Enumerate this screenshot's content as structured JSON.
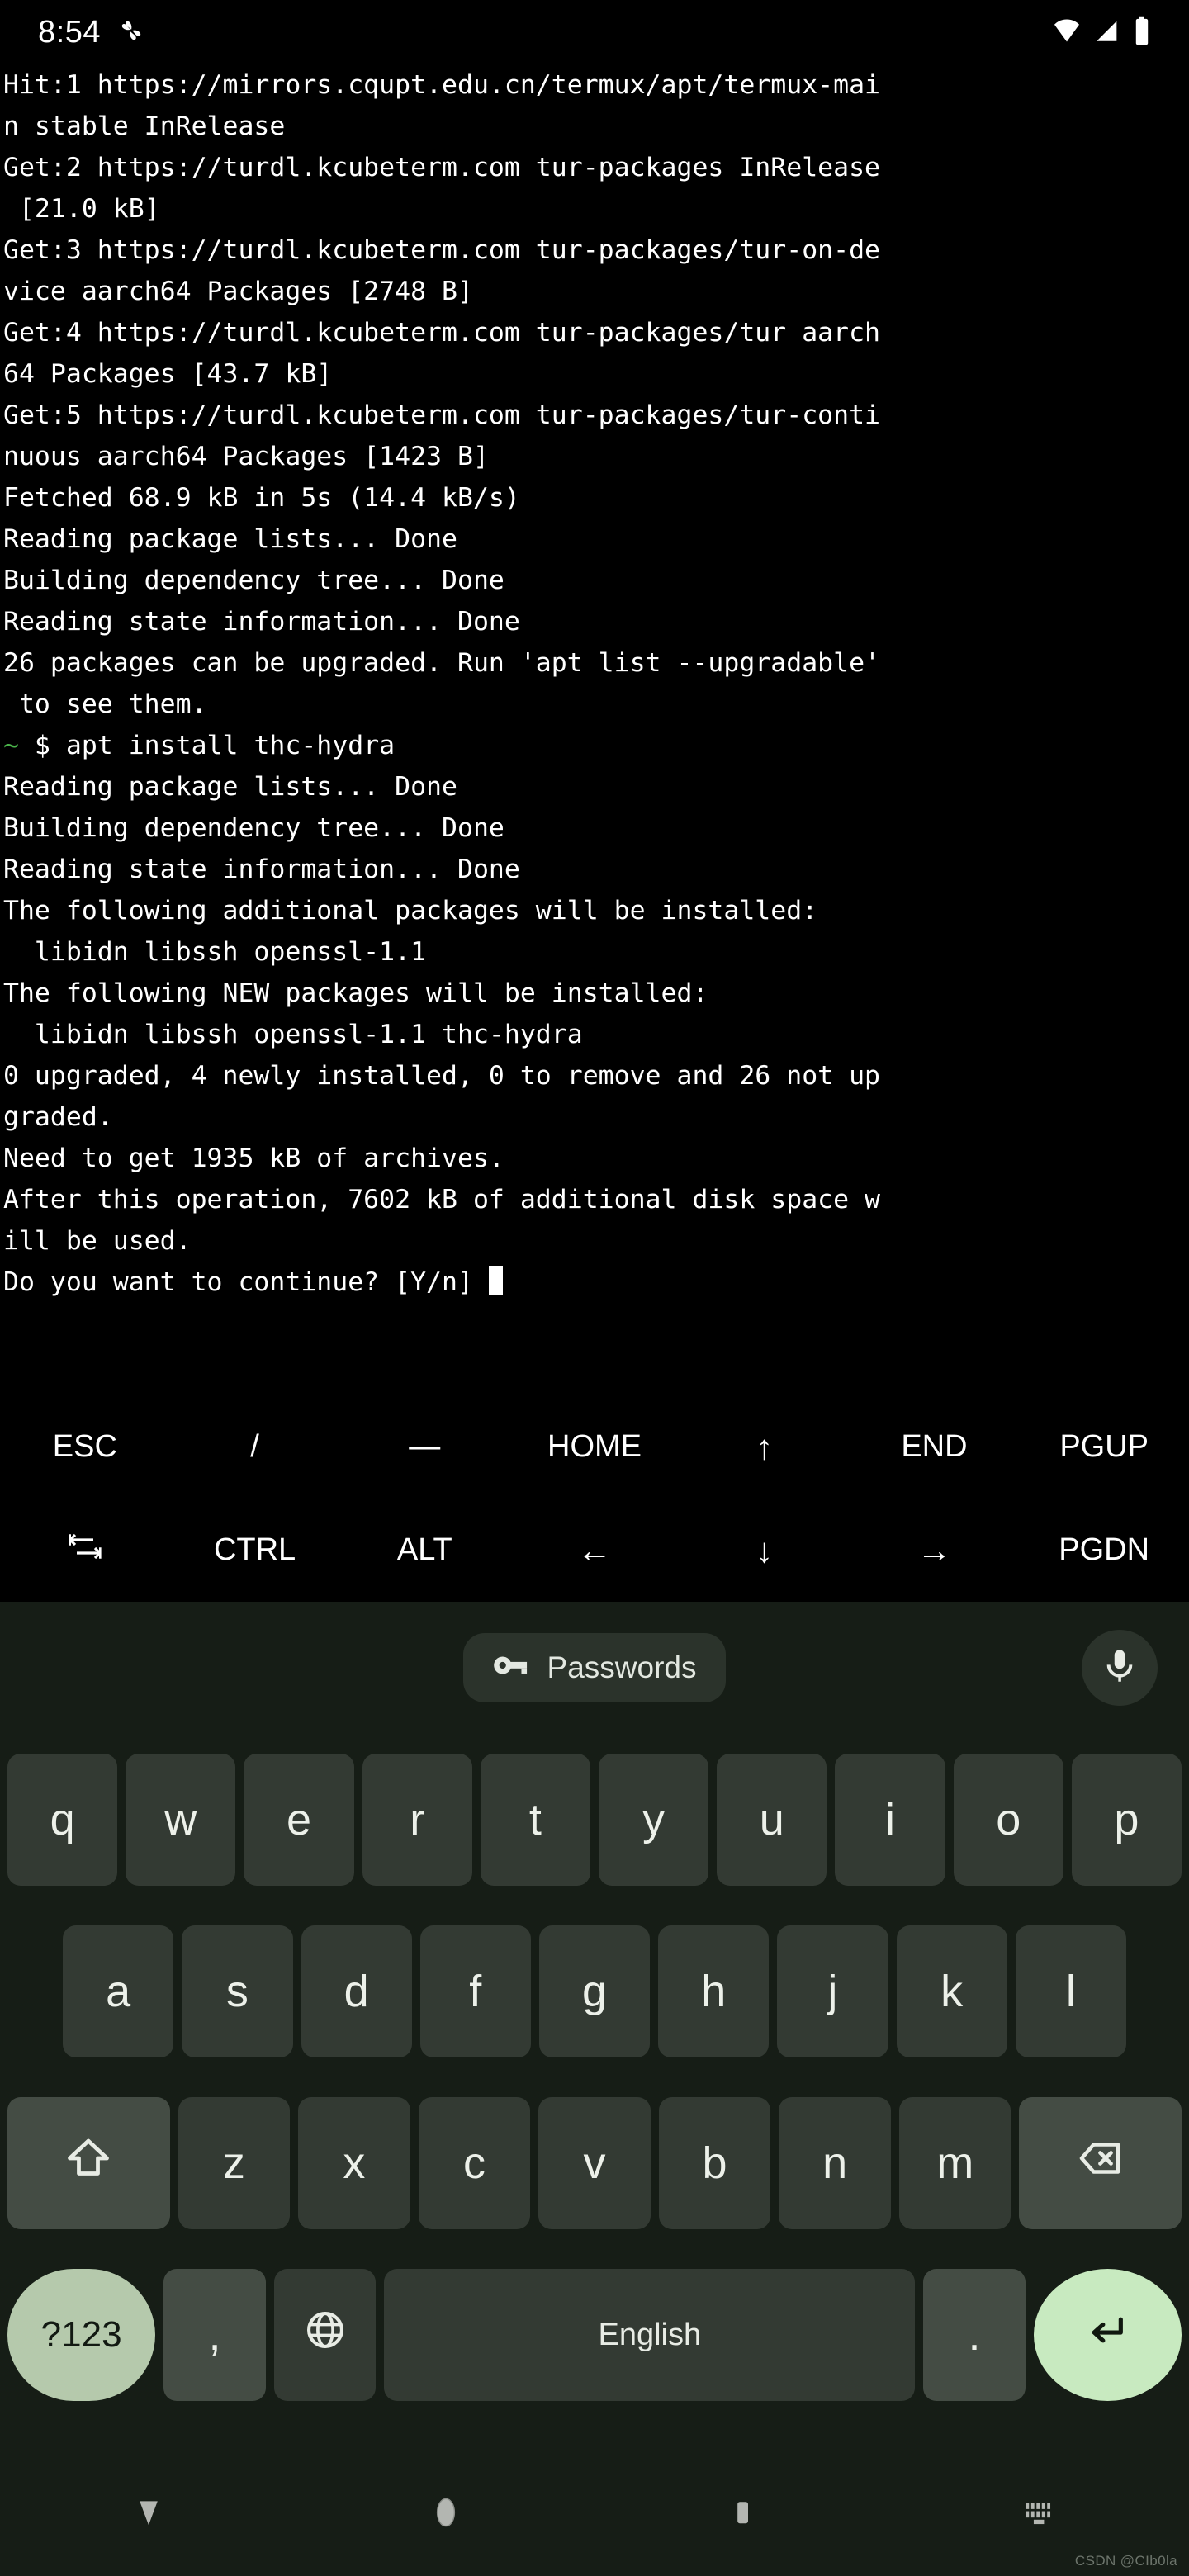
{
  "status_bar": {
    "time": "8:54",
    "icons": [
      "pinwheel-icon",
      "wifi-icon",
      "cellular-signal-icon",
      "battery-icon"
    ]
  },
  "terminal": {
    "background": "#000000",
    "foreground": "#ffffff",
    "prompt_color": "#4ab34a",
    "lines": [
      "Hit:1 https://mirrors.cqupt.edu.cn/termux/apt/termux-mai",
      "n stable InRelease",
      "Get:2 https://turdl.kcubeterm.com tur-packages InRelease",
      " [21.0 kB]",
      "Get:3 https://turdl.kcubeterm.com tur-packages/tur-on-de",
      "vice aarch64 Packages [2748 B]",
      "Get:4 https://turdl.kcubeterm.com tur-packages/tur aarch",
      "64 Packages [43.7 kB]",
      "Get:5 https://turdl.kcubeterm.com tur-packages/tur-conti",
      "nuous aarch64 Packages [1423 B]",
      "Fetched 68.9 kB in 5s (14.4 kB/s)",
      "Reading package lists... Done",
      "Building dependency tree... Done",
      "Reading state information... Done",
      "26 packages can be upgraded. Run 'apt list --upgradable'",
      " to see them.",
      "PROMPT_LINE",
      "Reading package lists... Done",
      "Building dependency tree... Done",
      "Reading state information... Done",
      "The following additional packages will be installed:",
      "  libidn libssh openssl-1.1",
      "The following NEW packages will be installed:",
      "  libidn libssh openssl-1.1 thc-hydra",
      "0 upgraded, 4 newly installed, 0 to remove and 26 not up",
      "graded.",
      "Need to get 1935 kB of archives.",
      "After this operation, 7602 kB of additional disk space w",
      "ill be used.",
      "CURSOR_LINE"
    ],
    "prompt_symbol": "~",
    "prompt_command": " $ apt install thc-hydra",
    "final_prompt": "Do you want to continue? [Y/n] "
  },
  "extra_keys": {
    "row1": [
      "ESC",
      "/",
      "—",
      "HOME",
      "↑",
      "END",
      "PGUP"
    ],
    "row2": [
      "TAB",
      "CTRL",
      "ALT",
      "←",
      "↓",
      "→",
      "PGDN"
    ],
    "row2_first_icon": "tab-icon"
  },
  "keyboard": {
    "suggestion": {
      "chip_label": "Passwords",
      "chip_icon": "key-icon",
      "mic_icon": "microphone-icon"
    },
    "row1": [
      "q",
      "w",
      "e",
      "r",
      "t",
      "y",
      "u",
      "i",
      "o",
      "p"
    ],
    "row2": [
      "a",
      "s",
      "d",
      "f",
      "g",
      "h",
      "j",
      "k",
      "l"
    ],
    "row3": {
      "shift_icon": "shift-icon",
      "letters": [
        "z",
        "x",
        "c",
        "v",
        "b",
        "n",
        "m"
      ],
      "backspace_icon": "backspace-icon"
    },
    "row4": {
      "symbols_label": "?123",
      "comma_label": ",",
      "globe_icon": "globe-icon",
      "space_label": "English",
      "period_label": ".",
      "enter_icon": "enter-icon"
    },
    "colors": {
      "background": "#161d16",
      "key": "#333a33",
      "key_dark": "#2b332b",
      "key_mid": "#444c44",
      "accent": "#b5c9ac",
      "enter": "#c8eac0",
      "text": "#edf1ea"
    }
  },
  "nav_bar": {
    "items": [
      "back-icon",
      "home-icon",
      "recents-icon",
      "hide-keyboard-icon"
    ]
  },
  "watermark": "CSDN @CIb0la"
}
